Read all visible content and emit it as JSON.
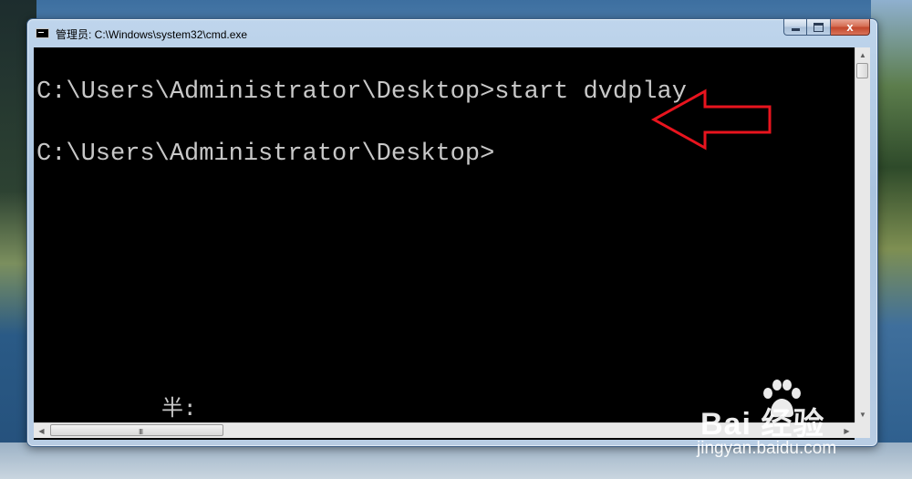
{
  "window": {
    "title": "管理员: C:\\Windows\\system32\\cmd.exe",
    "controls": {
      "minimize": "minimize",
      "maximize": "maximize",
      "close": "x"
    }
  },
  "console": {
    "lines": [
      "C:\\Users\\Administrator\\Desktop>start dvdplay",
      "C:\\Users\\Administrator\\Desktop>"
    ],
    "ime_status": "半:"
  },
  "annotation": {
    "arrow_color": "#e8141e",
    "arrow_direction": "left"
  },
  "scrollbars": {
    "horizontal_grip": "III"
  },
  "watermark": {
    "brand": "Bai 经验",
    "url": "jingyan.baidu.com"
  },
  "colors": {
    "console_bg": "#000000",
    "console_text": "#c8c8c8"
  }
}
